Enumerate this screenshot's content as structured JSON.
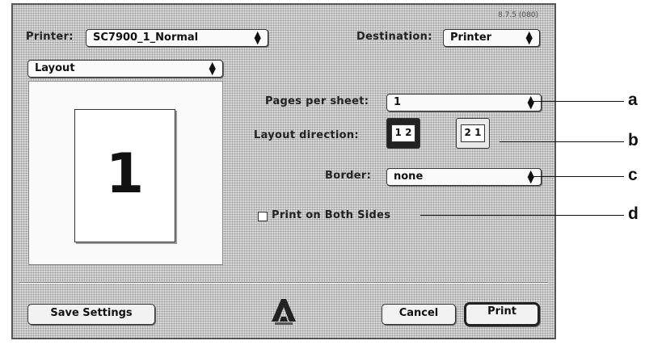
{
  "dialog": {
    "version": "8.7.5 (080)",
    "printer_label": "Printer:",
    "printer_value": "SC7900_1_Normal",
    "destination_label": "Destination:",
    "destination_value": "Printer",
    "panel_value": "Layout"
  },
  "preview": {
    "page_number": "1"
  },
  "layout": {
    "pages_per_sheet_label": "Pages per sheet:",
    "pages_per_sheet_value": "1",
    "layout_direction_label": "Layout direction:",
    "direction_option_1": "1 2",
    "direction_option_2": "2 1",
    "border_label": "Border:",
    "border_value": "none",
    "both_sides_label": "Print on Both Sides",
    "both_sides_checked": false
  },
  "footer": {
    "save_settings": "Save Settings",
    "cancel": "Cancel",
    "print": "Print",
    "logo_icon": "adobe-logo"
  },
  "callouts": [
    "a",
    "b",
    "c",
    "d"
  ]
}
